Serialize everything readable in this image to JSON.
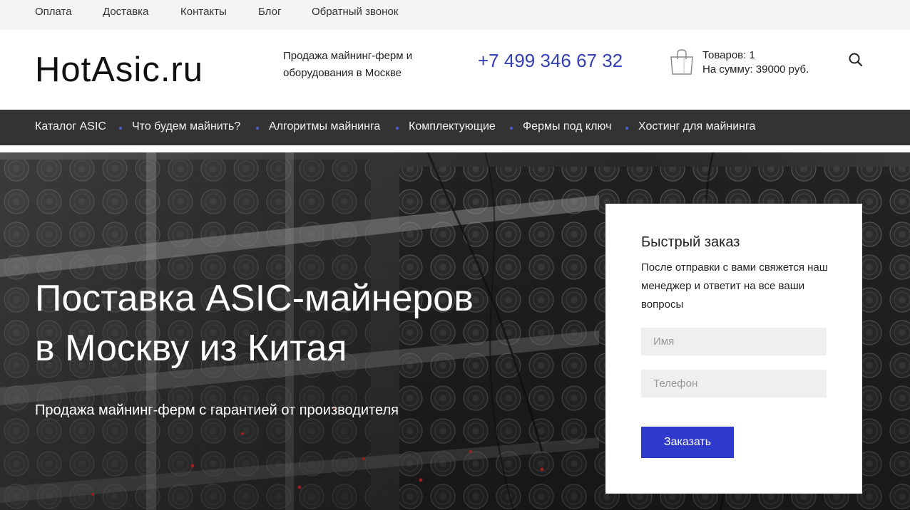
{
  "topbar": {
    "links": [
      "Оплата",
      "Доставка",
      "Контакты",
      "Блог",
      "Обратный звонок"
    ]
  },
  "header": {
    "logo": "HotAsic.ru",
    "tagline": "Продажа майнинг-ферм и оборудования в Москве",
    "phone": "+7 499 346 67 32",
    "cart": {
      "items": "Товаров: 1",
      "total": "На сумму: 39000 руб."
    },
    "icons": {
      "cart": "shopping-bag-icon",
      "search": "search-icon"
    }
  },
  "mainnav": {
    "items": [
      "Каталог ASIC",
      "Что будем майнить?",
      "Алгоритмы майнинга",
      "Комплектующие",
      "Фермы под ключ",
      "Хостинг для майнинга"
    ]
  },
  "hero": {
    "title_line1": "Поставка ASIC-майнеров",
    "title_line2": "в Москву из Китая",
    "subtitle": "Продажа майнинг-ферм с гарантией от производителя"
  },
  "order_form": {
    "title": "Быстрый заказ",
    "description": "После отправки с вами свяжется наш менеджер и ответит на все ваши вопросы",
    "name_placeholder": "Имя",
    "phone_placeholder": "Телефон",
    "submit_label": "Заказать"
  },
  "colors": {
    "accent": "#2d3acb",
    "phone": "#3540b4",
    "nav_bg": "#333333",
    "topbar_bg": "#f4f4f4"
  }
}
